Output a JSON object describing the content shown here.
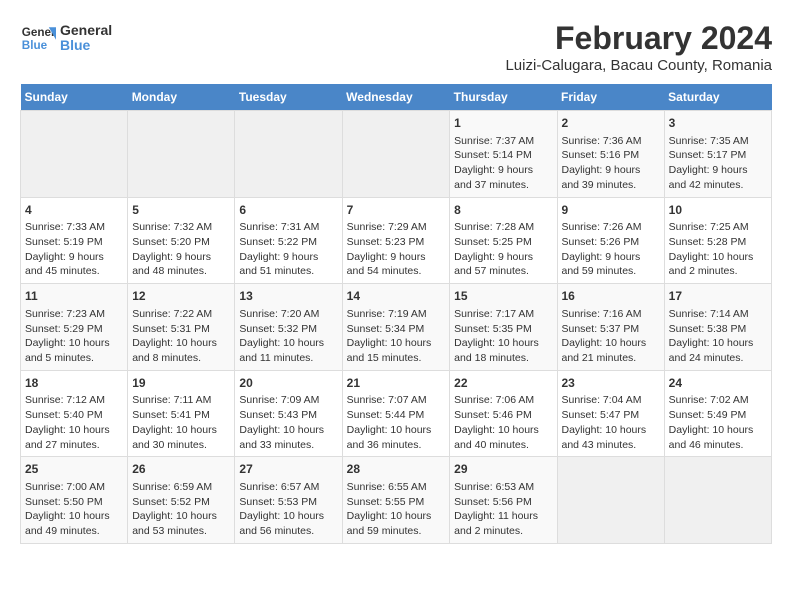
{
  "logo": {
    "line1": "General",
    "line2": "Blue"
  },
  "title": "February 2024",
  "subtitle": "Luizi-Calugara, Bacau County, Romania",
  "days_of_week": [
    "Sunday",
    "Monday",
    "Tuesday",
    "Wednesday",
    "Thursday",
    "Friday",
    "Saturday"
  ],
  "weeks": [
    [
      {
        "day": "",
        "info": ""
      },
      {
        "day": "",
        "info": ""
      },
      {
        "day": "",
        "info": ""
      },
      {
        "day": "",
        "info": ""
      },
      {
        "day": "1",
        "info": "Sunrise: 7:37 AM\nSunset: 5:14 PM\nDaylight: 9 hours and 37 minutes."
      },
      {
        "day": "2",
        "info": "Sunrise: 7:36 AM\nSunset: 5:16 PM\nDaylight: 9 hours and 39 minutes."
      },
      {
        "day": "3",
        "info": "Sunrise: 7:35 AM\nSunset: 5:17 PM\nDaylight: 9 hours and 42 minutes."
      }
    ],
    [
      {
        "day": "4",
        "info": "Sunrise: 7:33 AM\nSunset: 5:19 PM\nDaylight: 9 hours and 45 minutes."
      },
      {
        "day": "5",
        "info": "Sunrise: 7:32 AM\nSunset: 5:20 PM\nDaylight: 9 hours and 48 minutes."
      },
      {
        "day": "6",
        "info": "Sunrise: 7:31 AM\nSunset: 5:22 PM\nDaylight: 9 hours and 51 minutes."
      },
      {
        "day": "7",
        "info": "Sunrise: 7:29 AM\nSunset: 5:23 PM\nDaylight: 9 hours and 54 minutes."
      },
      {
        "day": "8",
        "info": "Sunrise: 7:28 AM\nSunset: 5:25 PM\nDaylight: 9 hours and 57 minutes."
      },
      {
        "day": "9",
        "info": "Sunrise: 7:26 AM\nSunset: 5:26 PM\nDaylight: 9 hours and 59 minutes."
      },
      {
        "day": "10",
        "info": "Sunrise: 7:25 AM\nSunset: 5:28 PM\nDaylight: 10 hours and 2 minutes."
      }
    ],
    [
      {
        "day": "11",
        "info": "Sunrise: 7:23 AM\nSunset: 5:29 PM\nDaylight: 10 hours and 5 minutes."
      },
      {
        "day": "12",
        "info": "Sunrise: 7:22 AM\nSunset: 5:31 PM\nDaylight: 10 hours and 8 minutes."
      },
      {
        "day": "13",
        "info": "Sunrise: 7:20 AM\nSunset: 5:32 PM\nDaylight: 10 hours and 11 minutes."
      },
      {
        "day": "14",
        "info": "Sunrise: 7:19 AM\nSunset: 5:34 PM\nDaylight: 10 hours and 15 minutes."
      },
      {
        "day": "15",
        "info": "Sunrise: 7:17 AM\nSunset: 5:35 PM\nDaylight: 10 hours and 18 minutes."
      },
      {
        "day": "16",
        "info": "Sunrise: 7:16 AM\nSunset: 5:37 PM\nDaylight: 10 hours and 21 minutes."
      },
      {
        "day": "17",
        "info": "Sunrise: 7:14 AM\nSunset: 5:38 PM\nDaylight: 10 hours and 24 minutes."
      }
    ],
    [
      {
        "day": "18",
        "info": "Sunrise: 7:12 AM\nSunset: 5:40 PM\nDaylight: 10 hours and 27 minutes."
      },
      {
        "day": "19",
        "info": "Sunrise: 7:11 AM\nSunset: 5:41 PM\nDaylight: 10 hours and 30 minutes."
      },
      {
        "day": "20",
        "info": "Sunrise: 7:09 AM\nSunset: 5:43 PM\nDaylight: 10 hours and 33 minutes."
      },
      {
        "day": "21",
        "info": "Sunrise: 7:07 AM\nSunset: 5:44 PM\nDaylight: 10 hours and 36 minutes."
      },
      {
        "day": "22",
        "info": "Sunrise: 7:06 AM\nSunset: 5:46 PM\nDaylight: 10 hours and 40 minutes."
      },
      {
        "day": "23",
        "info": "Sunrise: 7:04 AM\nSunset: 5:47 PM\nDaylight: 10 hours and 43 minutes."
      },
      {
        "day": "24",
        "info": "Sunrise: 7:02 AM\nSunset: 5:49 PM\nDaylight: 10 hours and 46 minutes."
      }
    ],
    [
      {
        "day": "25",
        "info": "Sunrise: 7:00 AM\nSunset: 5:50 PM\nDaylight: 10 hours and 49 minutes."
      },
      {
        "day": "26",
        "info": "Sunrise: 6:59 AM\nSunset: 5:52 PM\nDaylight: 10 hours and 53 minutes."
      },
      {
        "day": "27",
        "info": "Sunrise: 6:57 AM\nSunset: 5:53 PM\nDaylight: 10 hours and 56 minutes."
      },
      {
        "day": "28",
        "info": "Sunrise: 6:55 AM\nSunset: 5:55 PM\nDaylight: 10 hours and 59 minutes."
      },
      {
        "day": "29",
        "info": "Sunrise: 6:53 AM\nSunset: 5:56 PM\nDaylight: 11 hours and 2 minutes."
      },
      {
        "day": "",
        "info": ""
      },
      {
        "day": "",
        "info": ""
      }
    ]
  ]
}
